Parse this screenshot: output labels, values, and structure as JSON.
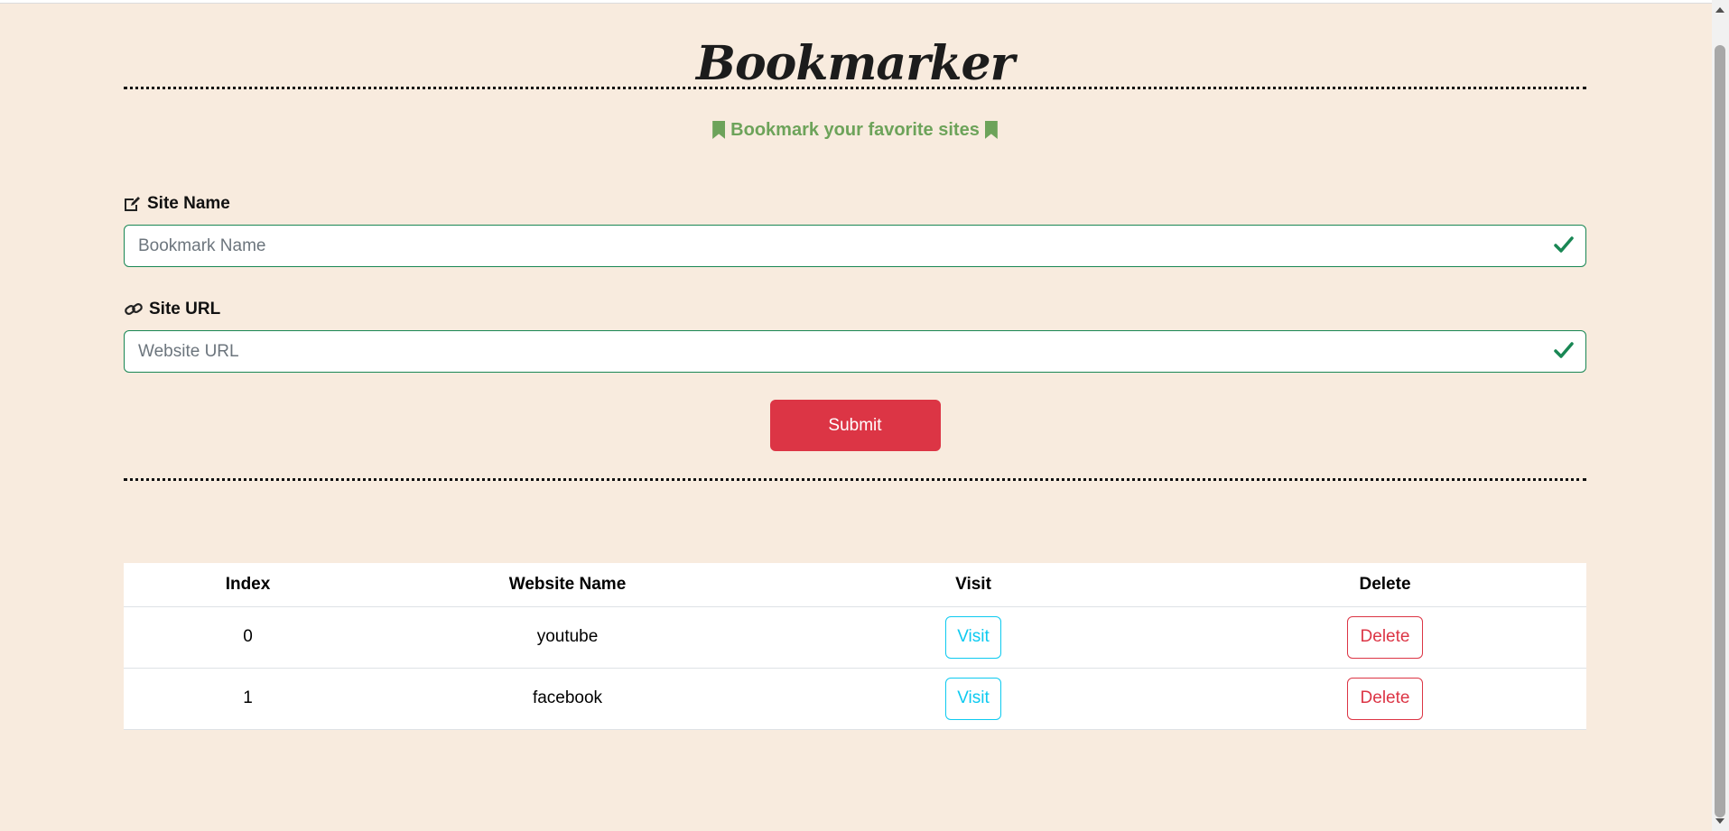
{
  "header": {
    "title": "Bookmarker",
    "subtitle": "Bookmark your favorite sites"
  },
  "form": {
    "site_name_label": "Site Name",
    "site_name_placeholder": "Bookmark Name",
    "site_url_label": "Site URL",
    "site_url_placeholder": "Website URL",
    "submit_label": "Submit"
  },
  "table": {
    "headers": [
      "Index",
      "Website Name",
      "Visit",
      "Delete"
    ],
    "rows": [
      {
        "index": "0",
        "name": "youtube",
        "visit": "Visit",
        "delete": "Delete"
      },
      {
        "index": "1",
        "name": "facebook",
        "visit": "Visit",
        "delete": "Delete"
      }
    ]
  },
  "colors": {
    "background": "#f8ebde",
    "accent_green": "#6da35a",
    "valid_green": "#198754",
    "danger": "#dc3545",
    "info": "#0dcaf0",
    "title_highlight": "#fbbf55"
  },
  "icons": {
    "subtitle": "bookmark-icon",
    "site_name": "pen-to-square-icon",
    "site_url": "link-icon",
    "valid": "check-icon"
  }
}
